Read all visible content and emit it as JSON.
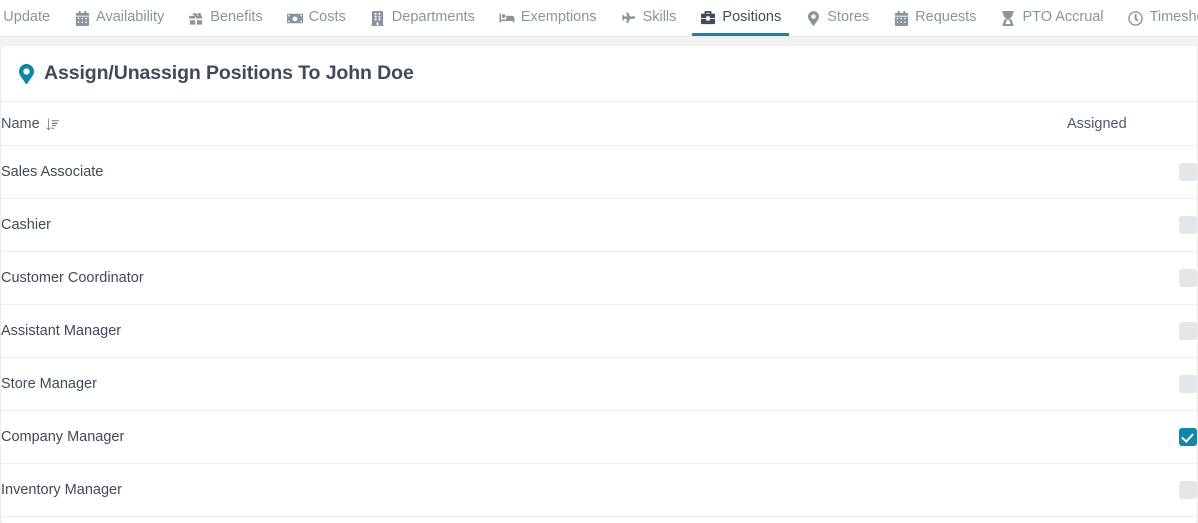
{
  "nav": {
    "items": [
      {
        "label": "Update",
        "icon": "cogs-icon",
        "active": false
      },
      {
        "label": "Availability",
        "icon": "calendar-icon",
        "active": false
      },
      {
        "label": "Benefits",
        "icon": "gift-icon",
        "active": false
      },
      {
        "label": "Costs",
        "icon": "money-bill-icon",
        "active": false
      },
      {
        "label": "Departments",
        "icon": "building-icon",
        "active": false
      },
      {
        "label": "Exemptions",
        "icon": "bed-icon",
        "active": false
      },
      {
        "label": "Skills",
        "icon": "plane-icon",
        "active": false
      },
      {
        "label": "Positions",
        "icon": "briefcase-icon",
        "active": true
      },
      {
        "label": "Stores",
        "icon": "map-marker-icon",
        "active": false
      },
      {
        "label": "Requests",
        "icon": "calendar-alt-icon",
        "active": false
      },
      {
        "label": "PTO Accrual",
        "icon": "hourglass-icon",
        "active": false
      },
      {
        "label": "Timesheet",
        "icon": "clock-icon",
        "active": false
      }
    ]
  },
  "page": {
    "title": "Assign/Unassign Positions To John Doe",
    "title_icon": "map-marker-icon"
  },
  "table": {
    "columns": {
      "name": "Name",
      "assigned": "Assigned"
    },
    "sort_icon": "sort-amount-down-icon",
    "rows": [
      {
        "name": "Sales Associate",
        "assigned": false
      },
      {
        "name": "Cashier",
        "assigned": false
      },
      {
        "name": "Customer Coordinator",
        "assigned": false
      },
      {
        "name": "Assistant Manager",
        "assigned": false
      },
      {
        "name": "Store Manager",
        "assigned": false
      },
      {
        "name": "Company Manager",
        "assigned": true
      },
      {
        "name": "Inventory Manager",
        "assigned": false
      }
    ]
  },
  "colors": {
    "accent": "#0e87a8",
    "text": "#3f4a5a",
    "muted": "#8a949e",
    "checkbox_off": "#e3e7ea"
  }
}
